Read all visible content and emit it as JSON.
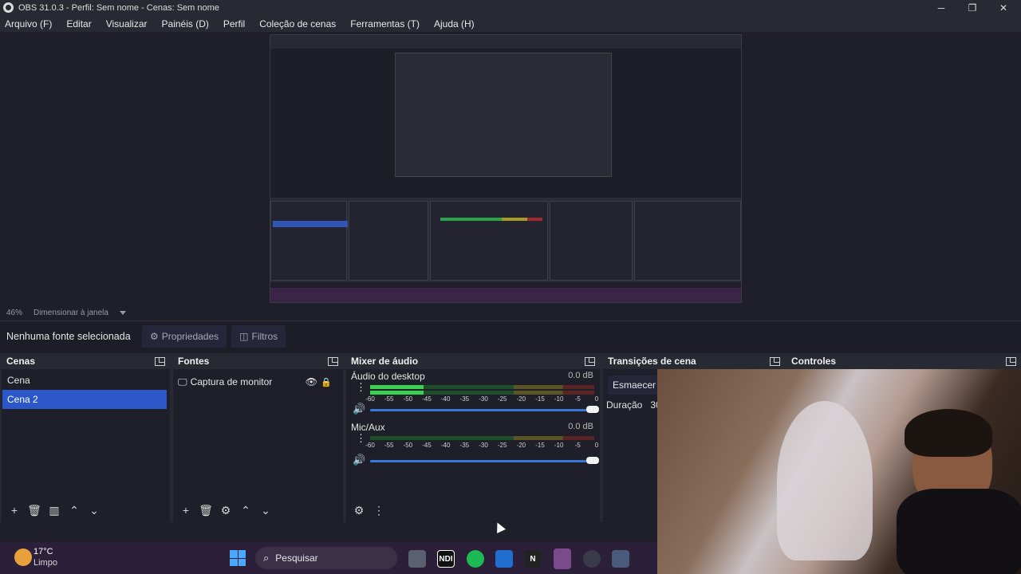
{
  "window": {
    "title": "OBS 31.0.3 - Perfil: Sem nome - Cenas: Sem nome",
    "minimize": "─",
    "maximize": "❐",
    "close": "✕"
  },
  "menu": [
    "Arquivo (F)",
    "Editar",
    "Visualizar",
    "Painéis (D)",
    "Perfil",
    "Coleção de cenas",
    "Ferramentas (T)",
    "Ajuda (H)"
  ],
  "zoom": {
    "percent": "46%",
    "mode": "Dimensionar à janela"
  },
  "source_toolbar": {
    "no_source": "Nenhuma fonte selecionada",
    "properties": "Propriedades",
    "filters": "Filtros"
  },
  "scenes": {
    "title": "Cenas",
    "items": [
      "Cena",
      "Cena 2"
    ],
    "selected_index": 1
  },
  "sources": {
    "title": "Fontes",
    "items": [
      {
        "name": "Captura de monitor",
        "visible": true,
        "locked": true
      }
    ]
  },
  "mixer": {
    "title": "Mixer de áudio",
    "ticks": [
      "-60",
      "-55",
      "-50",
      "-45",
      "-40",
      "-35",
      "-30",
      "-25",
      "-20",
      "-15",
      "-10",
      "-5",
      "0"
    ],
    "channels": [
      {
        "name": "Áudio do desktop",
        "db": "0.0 dB",
        "level": 0.24,
        "volume": 1.0
      },
      {
        "name": "Mic/Aux",
        "db": "0.0 dB",
        "level": 0.0,
        "volume": 1.0
      }
    ]
  },
  "transitions": {
    "title": "Transições de cena",
    "type": "Esmaecer",
    "duration_label": "Duração",
    "duration_value": "30"
  },
  "controls": {
    "title": "Controles"
  },
  "taskbar": {
    "weather_temp": "17°C",
    "weather_cond": "Limpo",
    "search": "Pesquisar",
    "apps": [
      "NDI",
      "N"
    ]
  },
  "colors": {
    "accent": "#2b57c9",
    "panel": "#1e1f29",
    "header": "#272a33",
    "meter_green": "#3bd150"
  }
}
